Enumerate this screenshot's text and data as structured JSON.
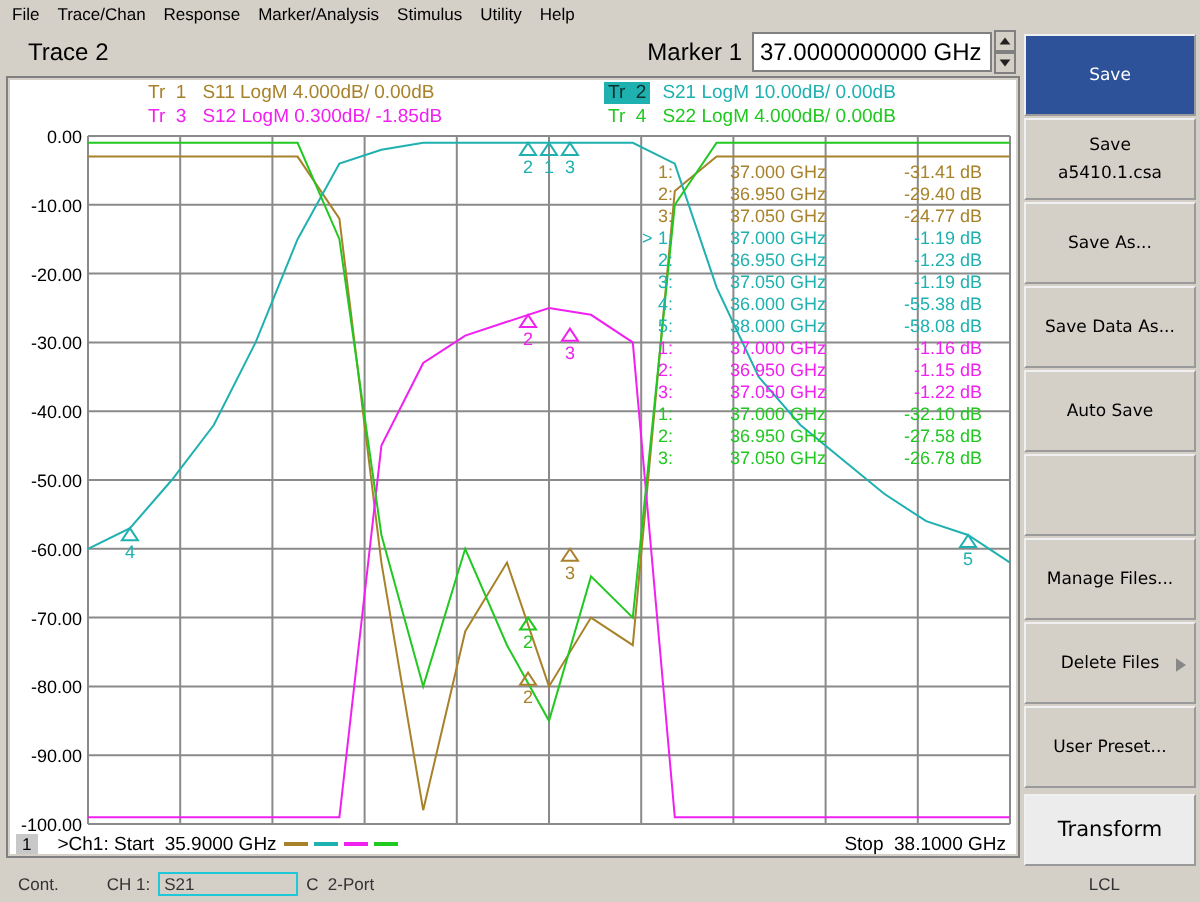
{
  "menu": [
    "File",
    "Trace/Chan",
    "Response",
    "Marker/Analysis",
    "Stimulus",
    "Utility",
    "Help"
  ],
  "header": {
    "title": "Trace 2",
    "marker_label": "Marker 1",
    "marker_value": "37.0000000000 GHz"
  },
  "traces": [
    {
      "tr": "Tr  1",
      "format": "LogM",
      "scale": "4.000dB/",
      "ref": "0.00dB",
      "color": "#a8822a",
      "selected": false
    },
    {
      "tr": "Tr  2",
      "format": "LogM",
      "scale": "10.00dB/",
      "ref": "0.00dB",
      "color": "#1fb0b0",
      "selected": true
    },
    {
      "tr": "Tr  3",
      "format": "LogM",
      "scale": "0.300dB/",
      "ref": "-1.85dB",
      "color": "#f020f0",
      "selected": false
    },
    {
      "tr": "Tr  4",
      "format": "LogM",
      "scale": "4.000dB/",
      "ref": "0.00dB",
      "color": "#20c820",
      "selected": false
    }
  ],
  "chart_data": {
    "type": "line",
    "categories": [
      null,
      null,
      null,
      null,
      null,
      null,
      null,
      null,
      null,
      null,
      null,
      null,
      null,
      null,
      null,
      null,
      null,
      null,
      null,
      null,
      null,
      null,
      null
    ],
    "series": [
      {
        "name": "S11",
        "color": "#a8822a",
        "values": [
          -3,
          -3,
          -3,
          -3,
          -3,
          -3,
          -12,
          -62,
          -98,
          -72,
          -62,
          -80,
          -70,
          -74,
          -8,
          -3,
          -3,
          -3,
          -3,
          -3,
          -3,
          -3,
          -3
        ]
      },
      {
        "name": "S21",
        "color": "#1fb0b0",
        "values": [
          -60,
          -57,
          -50,
          -42,
          -30,
          -15,
          -4,
          -2,
          -1,
          -1,
          -1,
          -1,
          -1,
          -1,
          -4,
          -22,
          -35,
          -42,
          -47,
          -52,
          -56,
          -58,
          -62
        ]
      },
      {
        "name": "S12",
        "color": "#f020f0",
        "values": [
          -99,
          -99,
          -99,
          -99,
          -99,
          -99,
          -99,
          -45,
          -33,
          -29,
          -27,
          -25,
          -26,
          -30,
          -99,
          -99,
          -99,
          -99,
          -99,
          -99,
          -99,
          -99,
          -99
        ]
      },
      {
        "name": "S22",
        "color": "#20c820",
        "values": [
          -1,
          -1,
          -1,
          -1,
          -1,
          -1,
          -15,
          -58,
          -80,
          -60,
          -74,
          -85,
          -64,
          -70,
          -10,
          -1,
          -1,
          -1,
          -1,
          -1,
          -1,
          -1,
          -1
        ]
      }
    ],
    "ylim": [
      -100,
      0
    ],
    "grid": true,
    "yticks": [
      {
        "value": 0,
        "label": "0.00"
      },
      {
        "value": -10,
        "label": "-10.00"
      },
      {
        "value": -20,
        "label": "-20.00"
      },
      {
        "value": -30,
        "label": "-30.00"
      },
      {
        "value": -40,
        "label": "-40.00"
      },
      {
        "value": -50,
        "label": "-50.00"
      },
      {
        "value": -60,
        "label": "-60.00"
      },
      {
        "value": -70,
        "label": "-70.00"
      },
      {
        "value": -80,
        "label": "-80.00"
      },
      {
        "value": -90,
        "label": "-90.00"
      },
      {
        "value": -100,
        "label": "-100.00"
      }
    ]
  },
  "plot_markers": [
    {
      "label": "4",
      "color": "#1fb0b0"
    },
    {
      "label": "2",
      "color": "#1fb0b0"
    },
    {
      "label": "2",
      "color": "#f020f0"
    },
    {
      "label": "2",
      "color": "#20c820"
    },
    {
      "label": "2",
      "color": "#a8822a"
    },
    {
      "label": "1",
      "color": "#1fb0b0"
    },
    {
      "label": "3",
      "color": "#1fb0b0"
    },
    {
      "label": "3",
      "color": "#f020f0"
    },
    {
      "label": "3",
      "color": "#a8822a"
    },
    {
      "label": "5",
      "color": "#1fb0b0"
    }
  ],
  "marker_table": [
    {
      "color": "#a8822a",
      "label": "1:",
      "freq": "37.000 GHz",
      "value": "-31.41 dB"
    },
    {
      "color": "#a8822a",
      "label": "2:",
      "freq": "36.950 GHz",
      "value": "-29.40 dB"
    },
    {
      "color": "#a8822a",
      "label": "3:",
      "freq": "37.050 GHz",
      "value": "-24.77 dB"
    },
    {
      "color": "#1fb0b0",
      "pointer": ">",
      "label": "1:",
      "freq": "37.000 GHz",
      "value": "-1.19 dB"
    },
    {
      "color": "#1fb0b0",
      "label": "2:",
      "freq": "36.950 GHz",
      "value": "-1.23 dB"
    },
    {
      "color": "#1fb0b0",
      "label": "3:",
      "freq": "37.050 GHz",
      "value": "-1.19 dB"
    },
    {
      "color": "#1fb0b0",
      "label": "4:",
      "freq": "36.000 GHz",
      "value": "-55.38 dB"
    },
    {
      "color": "#1fb0b0",
      "label": "5:",
      "freq": "38.000 GHz",
      "value": "-58.08 dB"
    },
    {
      "color": "#f020f0",
      "label": "1:",
      "freq": "37.000 GHz",
      "value": "-1.16 dB"
    },
    {
      "color": "#f020f0",
      "label": "2:",
      "freq": "36.950 GHz",
      "value": "-1.15 dB"
    },
    {
      "color": "#f020f0",
      "label": "3:",
      "freq": "37.050 GHz",
      "value": "-1.22 dB"
    },
    {
      "color": "#20c820",
      "label": "1:",
      "freq": "37.000 GHz",
      "value": "-32.10 dB"
    },
    {
      "color": "#20c820",
      "label": "2:",
      "freq": "36.950 GHz",
      "value": "-27.58 dB"
    },
    {
      "color": "#20c820",
      "label": "3:",
      "freq": "37.050 GHz",
      "value": "-26.78 dB"
    }
  ],
  "footer": {
    "channel": "1",
    "start": ">Ch1: Start  35.9000 GHz",
    "stop": "Stop  38.1000 GHz"
  },
  "softkeys": [
    {
      "lines": [
        "Save"
      ],
      "kind": "primary",
      "submenu": false
    },
    {
      "lines": [
        "Save",
        "a5410.1.csa"
      ],
      "kind": "normal",
      "submenu": false
    },
    {
      "lines": [
        "Save As..."
      ],
      "kind": "normal",
      "submenu": false
    },
    {
      "lines": [
        "Save Data As..."
      ],
      "kind": "normal",
      "submenu": false
    },
    {
      "lines": [
        "Auto Save"
      ],
      "kind": "normal",
      "submenu": false
    },
    {
      "kind": "normal",
      "submenu": false
    },
    {
      "lines": [
        "Manage Files..."
      ],
      "kind": "normal",
      "submenu": false
    },
    {
      "lines": [
        "Delete Files"
      ],
      "kind": "normal",
      "submenu": true
    },
    {
      "lines": [
        "User Preset..."
      ],
      "kind": "normal",
      "submenu": false
    },
    {
      "lines": [
        "Transform"
      ],
      "kind": "light",
      "submenu": false
    }
  ],
  "status_bar": {
    "mode": "Cont.",
    "channel": "CH 1:",
    "measurement": "S21",
    "cal": "C  2-Port",
    "remote": "LCL"
  }
}
